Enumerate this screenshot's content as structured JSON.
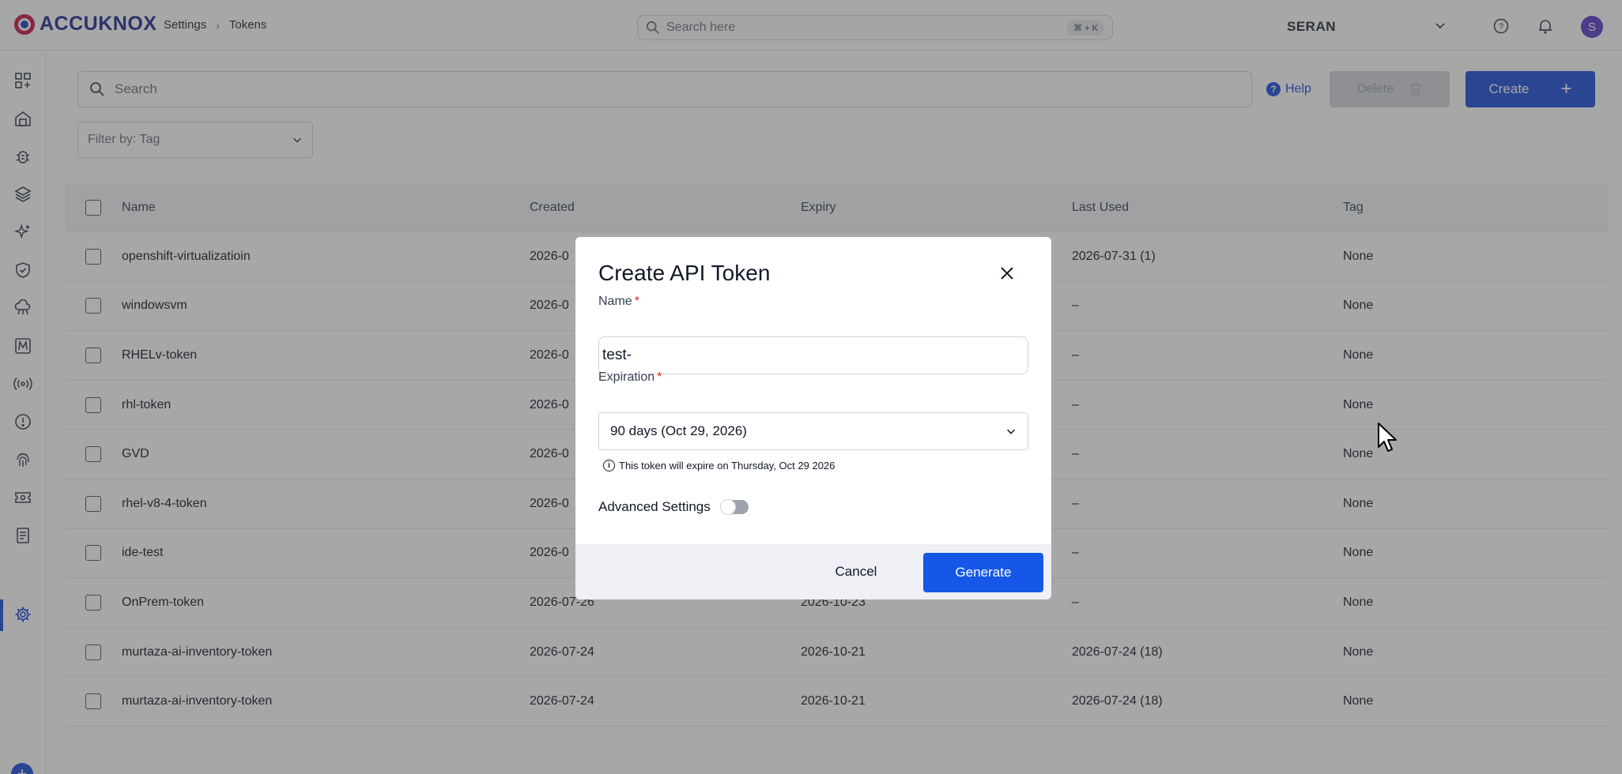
{
  "brand": {
    "name": "ACCUKNOX"
  },
  "breadcrumb": {
    "parent": "Settings",
    "current": "Tokens"
  },
  "global_search": {
    "placeholder": "Search here",
    "shortcut": "⌘ + K"
  },
  "org": {
    "name": "SERAN"
  },
  "user": {
    "initial": "S"
  },
  "toolbar": {
    "search_placeholder": "Search",
    "help_label": "Help",
    "delete_label": "Delete",
    "create_label": "Create",
    "filter_placeholder": "Filter by: Tag"
  },
  "table": {
    "columns": [
      "Name",
      "Created",
      "Expiry",
      "Last Used",
      "Tag"
    ],
    "rows": [
      {
        "name": "openshift-virtualizatioin",
        "created": "2026-0",
        "expiry": "",
        "last_used": "2026-07-31 (1)",
        "tag": "None"
      },
      {
        "name": "windowsvm",
        "created": "2026-0",
        "expiry": "",
        "last_used": "–",
        "tag": "None"
      },
      {
        "name": "RHELv-token",
        "created": "2026-0",
        "expiry": "",
        "last_used": "–",
        "tag": "None"
      },
      {
        "name": "rhl-token",
        "created": "2026-0",
        "expiry": "",
        "last_used": "–",
        "tag": "None"
      },
      {
        "name": "GVD",
        "created": "2026-0",
        "expiry": "",
        "last_used": "–",
        "tag": "None"
      },
      {
        "name": "rhel-v8-4-token",
        "created": "2026-0",
        "expiry": "",
        "last_used": "–",
        "tag": "None"
      },
      {
        "name": "ide-test",
        "created": "2026-0",
        "expiry": "",
        "last_used": "–",
        "tag": "None"
      },
      {
        "name": "OnPrem-token",
        "created": "2026-07-26",
        "expiry": "2026-10-23",
        "last_used": "–",
        "tag": "None"
      },
      {
        "name": "murtaza-ai-inventory-token",
        "created": "2026-07-24",
        "expiry": "2026-10-21",
        "last_used": "2026-07-24 (18)",
        "tag": "None"
      },
      {
        "name": "murtaza-ai-inventory-token",
        "created": "2026-07-24",
        "expiry": "2026-10-21",
        "last_used": "2026-07-24 (18)",
        "tag": "None"
      }
    ]
  },
  "modal": {
    "title": "Create API Token",
    "name_label": "Name",
    "name_value": "test-",
    "expiration_label": "Expiration",
    "expiration_value": "90 days (Oct 29, 2026)",
    "expiration_note": "This token will expire on Thursday, Oct 29 2026",
    "advanced_label": "Advanced Settings",
    "advanced_enabled": false,
    "cancel_label": "Cancel",
    "generate_label": "Generate"
  },
  "colors": {
    "primary": "#1d4ed8",
    "generate": "#1657e8",
    "required": "#dc2626",
    "avatar": "#5b3dc8"
  }
}
